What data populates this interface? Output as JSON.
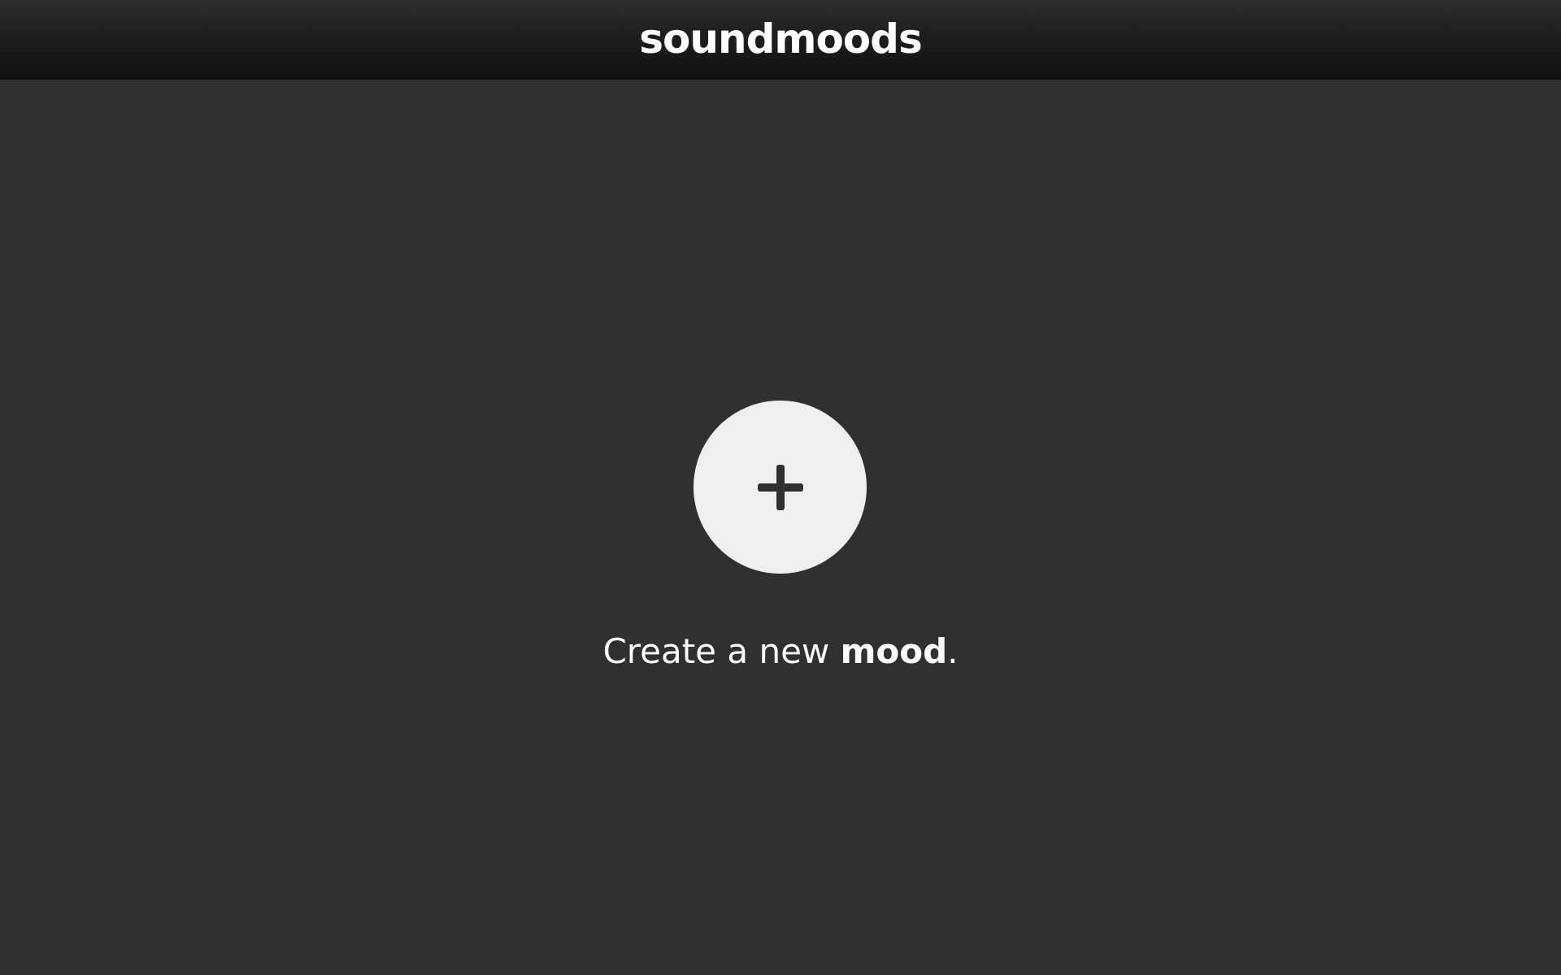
{
  "header": {
    "title": "soundmoods"
  },
  "main": {
    "create_button_icon": "plus-icon",
    "caption_prefix": "Create a new ",
    "caption_emphasis": "mood",
    "caption_suffix": "."
  },
  "colors": {
    "background": "#303030",
    "button": "#efefef",
    "text": "#ffffff"
  }
}
